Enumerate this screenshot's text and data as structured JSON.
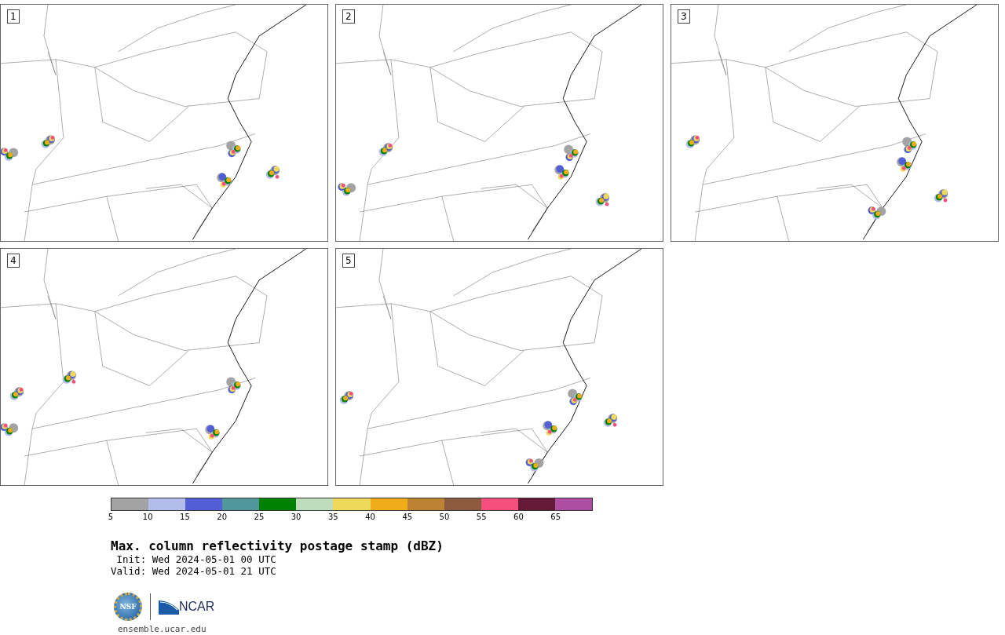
{
  "panels": [
    {
      "label": "1"
    },
    {
      "label": "2"
    },
    {
      "label": "3"
    },
    {
      "label": "4"
    },
    {
      "label": "5"
    }
  ],
  "colorbar": {
    "segments": [
      {
        "color": "#a3a3a3"
      },
      {
        "color": "#b3bdeb"
      },
      {
        "color": "#525ed6"
      },
      {
        "color": "#50969b"
      },
      {
        "color": "#008200"
      },
      {
        "color": "#bcdcbc"
      },
      {
        "color": "#eed95a"
      },
      {
        "color": "#f0ad19"
      },
      {
        "color": "#bb8233"
      },
      {
        "color": "#8b5a3f"
      },
      {
        "color": "#f44f7d"
      },
      {
        "color": "#641a37"
      },
      {
        "color": "#ad4ea3"
      }
    ],
    "ticks": [
      "5",
      "10",
      "15",
      "20",
      "25",
      "30",
      "35",
      "40",
      "45",
      "50",
      "55",
      "60",
      "65"
    ]
  },
  "title": "Max. column reflectivity postage stamp (dBZ)",
  "init": " Init: Wed 2024-05-01 00 UTC",
  "valid": "Valid: Wed 2024-05-01 21 UTC",
  "logo": {
    "left": "NSF",
    "right": "NCAR"
  },
  "footer": "ensemble.ucar.edu"
}
